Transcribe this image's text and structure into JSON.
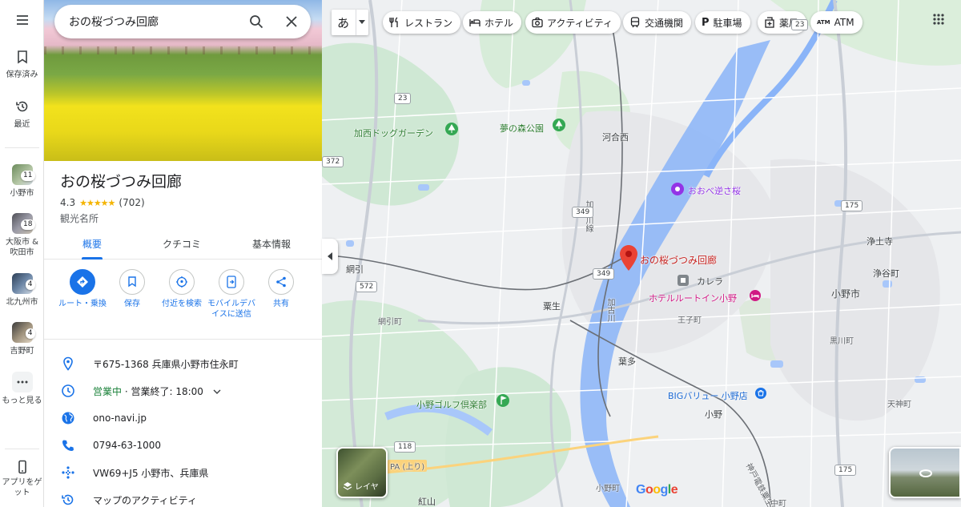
{
  "rail": {
    "saved_label": "保存済み",
    "recent_label": "最近",
    "recents": [
      {
        "label": "小野市",
        "count": "11"
      },
      {
        "label": "大阪市 &\n吹田市",
        "count": "18"
      },
      {
        "label": "北九州市",
        "count": "4"
      },
      {
        "label": "吉野町",
        "count": "4"
      }
    ],
    "more_label": "もっと見る",
    "get_app_label": "アプリをゲット"
  },
  "search": {
    "value": "おの桜づつみ回廊"
  },
  "place": {
    "title": "おの桜づつみ回廊",
    "rating": "4.3",
    "stars": "★★★★★",
    "reviews": "(702)",
    "category": "観光名所"
  },
  "tabs": [
    {
      "label": "概要",
      "active": true
    },
    {
      "label": "クチコミ",
      "active": false
    },
    {
      "label": "基本情報",
      "active": false
    }
  ],
  "actions": [
    {
      "label": "ルート・乗換",
      "icon": "directions-icon"
    },
    {
      "label": "保存",
      "icon": "bookmark-icon"
    },
    {
      "label": "付近を検索",
      "icon": "nearby-icon"
    },
    {
      "label": "モバイルデバイスに送信",
      "icon": "send-to-phone-icon"
    },
    {
      "label": "共有",
      "icon": "share-icon"
    }
  ],
  "info": {
    "address": "〒675-1368 兵庫県小野市住永町",
    "open_status": "営業中",
    "hours": " · 営業終了: 18:00",
    "website": "ono-navi.jp",
    "phone": "0794-63-1000",
    "plus_code": "VW69+J5 小野市、兵庫県",
    "activity": "マップのアクティビティ"
  },
  "map": {
    "ime_label": "あ",
    "chips": [
      "レストラン",
      "ホテル",
      "アクティビティ",
      "交通機関",
      "駐車場",
      "薬局",
      "ATM"
    ],
    "labels": {
      "dog_garden": "加西ドッグガーデン",
      "yume_park": "夢の森公園",
      "kasai_nishi": "河合西",
      "oobe": "おおべ逆さ桜",
      "kakogawa_river": "加古川",
      "jodoji": "浄土寺",
      "jodoji_station": "浄谷町",
      "amibiki": "網引",
      "amibiki_town": "網引町",
      "awaoi": "粟生",
      "karera": "カレラ",
      "hotel": "ホテルルートイン小野",
      "ono_city": "小野市",
      "ouji": "王子町",
      "kurokawa": "黒川町",
      "haita": "葉多",
      "big_value": "BIGバリュー 小野店",
      "golf": "小野ゴルフ倶楽部",
      "ono_station": "小野",
      "tenjin": "天神町",
      "ono_town": "小野町",
      "beniyama": "紅山",
      "place_pin": "おの桜づつみ回廊",
      "kakogawa_line": "加古川線",
      "pa_label": "PA (上り)",
      "kitasaigoku": "神戸電鉄粟生線",
      "nakamachi": "中町"
    },
    "shields": [
      "23",
      "372",
      "349",
      "175",
      "572",
      "349",
      "118",
      "23",
      "175"
    ],
    "layer_label": "レイヤ",
    "google": "Google"
  }
}
